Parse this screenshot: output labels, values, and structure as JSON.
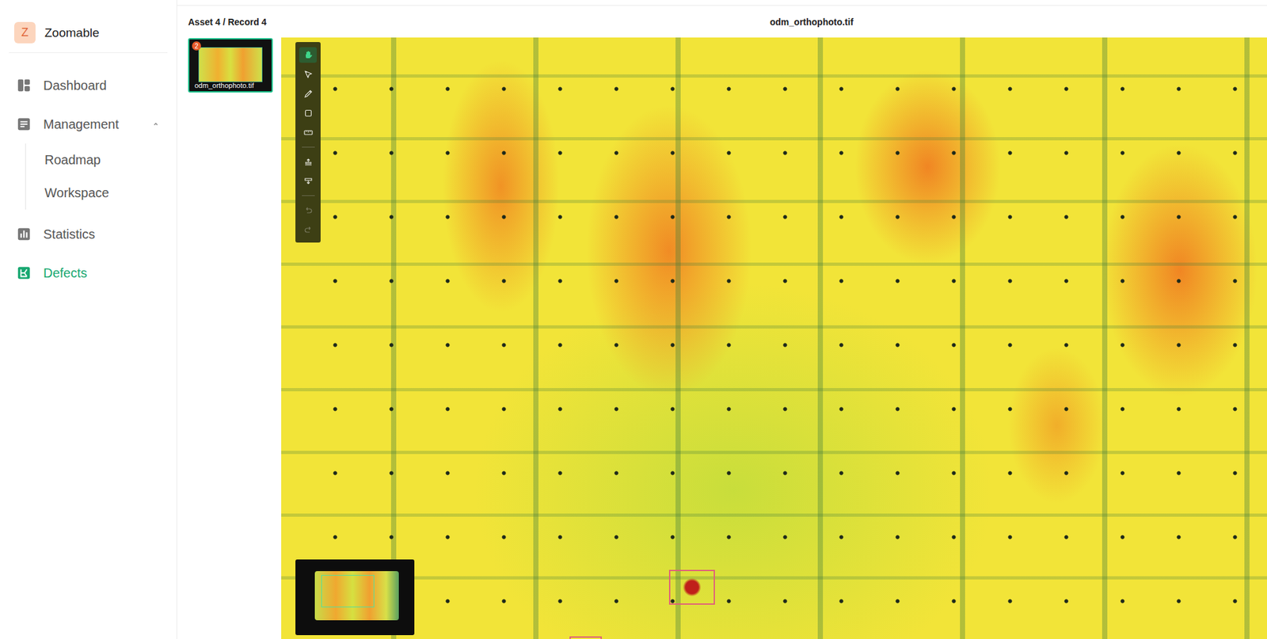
{
  "brand": {
    "letter": "Z",
    "name": "Zoomable"
  },
  "sidebar": {
    "items": [
      {
        "label": "Dashboard",
        "selected": false,
        "expanded": false,
        "children": []
      },
      {
        "label": "Management",
        "selected": false,
        "expanded": true,
        "children": [
          {
            "label": "Roadmap",
            "selected": false
          },
          {
            "label": "Workspace",
            "selected": false
          }
        ]
      },
      {
        "label": "Statistics",
        "selected": false,
        "expanded": false,
        "children": []
      },
      {
        "label": "Defects",
        "selected": true,
        "expanded": false,
        "children": []
      }
    ]
  },
  "header": {
    "breadcrumb": "Asset 4 / Record 4",
    "title": "odm_orthophoto.tif"
  },
  "thumbnails": [
    {
      "label": "odm_orthophoto.tif",
      "badge": "2",
      "selected": true
    }
  ],
  "toolbar": {
    "tools": [
      {
        "selected": true,
        "disabled": false
      },
      {
        "selected": false,
        "disabled": false
      },
      {
        "selected": false,
        "disabled": false
      },
      {
        "selected": false,
        "disabled": false
      },
      {
        "selected": false,
        "disabled": false
      },
      {
        "selected": false,
        "disabled": false
      },
      {
        "selected": false,
        "disabled": false
      },
      {
        "selected": false,
        "disabled": true
      },
      {
        "selected": false,
        "disabled": true
      }
    ]
  }
}
